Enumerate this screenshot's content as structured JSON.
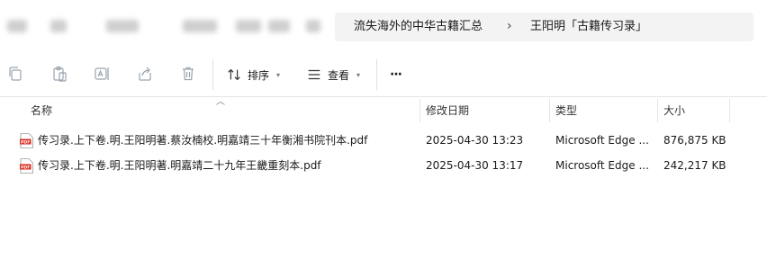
{
  "breadcrumb": {
    "items": [
      "流失海外的中华古籍汇总",
      "王阳明「古籍传习录」"
    ],
    "separator": "›"
  },
  "toolbar": {
    "sort_label": "排序",
    "view_label": "查看",
    "more_label": "···",
    "icons": [
      "copy-icon",
      "paste-icon",
      "rename-icon",
      "share-icon",
      "delete-icon",
      "sort-icon",
      "view-icon",
      "more-icon"
    ]
  },
  "columns": {
    "name": "名称",
    "modified": "修改日期",
    "type": "类型",
    "size": "大小"
  },
  "files": [
    {
      "name": "传习录.上下卷.明.王阳明著.蔡汝楠校.明嘉靖三十年衡湘书院刊本.pdf",
      "modified": "2025-04-30 13:23",
      "type": "Microsoft Edge ...",
      "size": "876,875 KB",
      "icon": "pdf-icon"
    },
    {
      "name": "传习录.上下卷.明.王阳明著.明嘉靖二十九年王畿重刻本.pdf",
      "modified": "2025-04-30 13:17",
      "type": "Microsoft Edge ...",
      "size": "242,217 KB",
      "icon": "pdf-icon"
    }
  ],
  "colors": {
    "pdf_red": "#d9281c",
    "addr_bg": "#f3f3f3",
    "border": "#e5e5e5"
  }
}
